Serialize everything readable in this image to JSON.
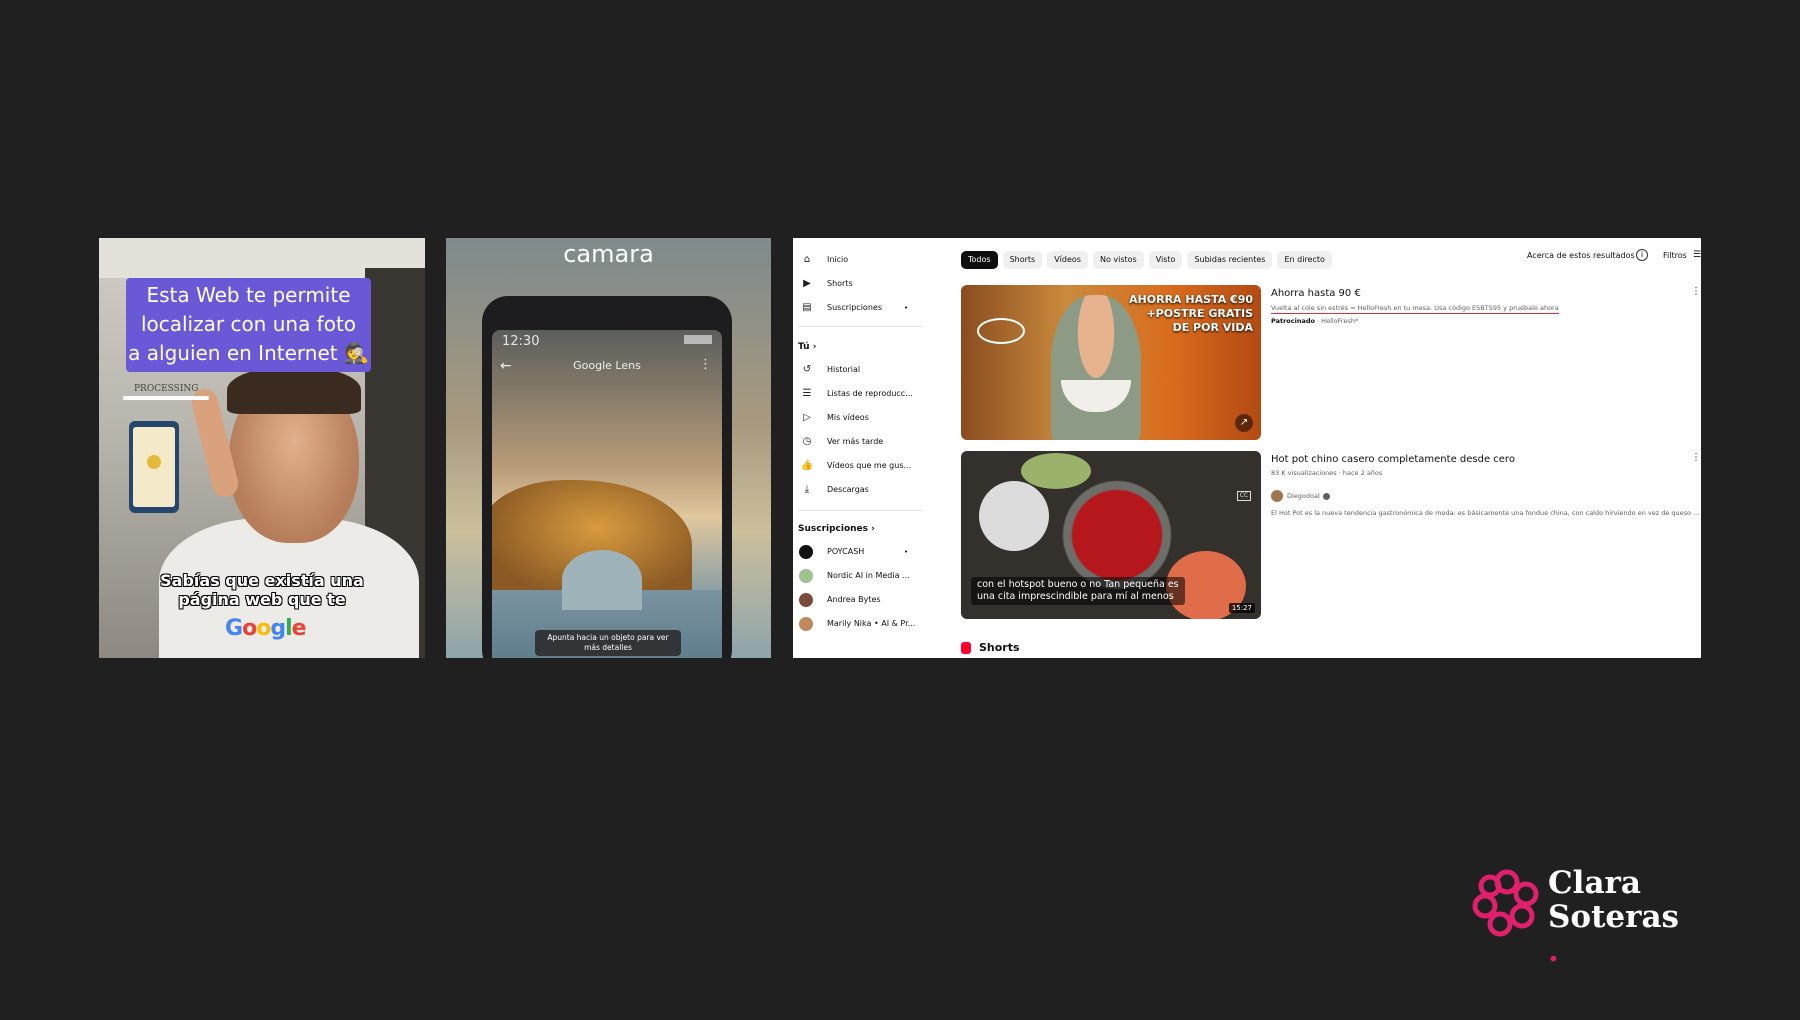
{
  "panel_tiktok": {
    "caption_lines": [
      "Esta Web te permite",
      "localizar con una foto",
      "a alguien en Internet 🕵"
    ],
    "progress_label": "PROCESSING",
    "subtitle_lines": [
      "Sabías que existía una",
      "página web que te"
    ],
    "logo_text": "Google"
  },
  "panel_lens": {
    "title": "camara",
    "time": "12:30",
    "app_label": "Google Lens",
    "hint": "Apunta hacia un objeto para ver más detalles"
  },
  "youtube": {
    "nav": [
      {
        "icon": "home-icon",
        "glyph": "⌂",
        "label": "Inicio"
      },
      {
        "icon": "shorts-icon",
        "glyph": "▶",
        "label": "Shorts"
      },
      {
        "icon": "subscriptions-icon",
        "glyph": "▤",
        "label": "Suscripciones",
        "dot": "•"
      }
    ],
    "you_header": "Tú  ›",
    "you_items": [
      {
        "icon": "history-icon",
        "glyph": "↺",
        "label": "Historial"
      },
      {
        "icon": "playlists-icon",
        "glyph": "☰",
        "label": "Listas de reproducc..."
      },
      {
        "icon": "my-videos-icon",
        "glyph": "▷",
        "label": "Mis vídeos"
      },
      {
        "icon": "watch-later-icon",
        "glyph": "◷",
        "label": "Ver más tarde"
      },
      {
        "icon": "liked-icon",
        "glyph": "👍",
        "label": "Vídeos que me gus..."
      },
      {
        "icon": "downloads-icon",
        "glyph": "⤓",
        "label": "Descargas"
      }
    ],
    "subs_header": "Suscripciones  ›",
    "subs": [
      {
        "label": "POYCASH",
        "color": "#111111",
        "dot": "•"
      },
      {
        "label": "Nordic AI in Media ...",
        "color": "#9bc48f"
      },
      {
        "label": "Andrea Bytes",
        "color": "#7b4a3a"
      },
      {
        "label": "Marily Nika • AI & Pr...",
        "color": "#c0865e"
      }
    ],
    "chips": [
      "Todos",
      "Shorts",
      "Vídeos",
      "No vistos",
      "Visto",
      "Subidas recientes",
      "En directo"
    ],
    "active_chip": "Todos",
    "about_results": "Acerca de estos resultados",
    "filters": "Filtros",
    "ad": {
      "promo_lines": [
        "AHORRA HASTA €90",
        "+POSTRE GRATIS",
        "DE POR VIDA"
      ],
      "title": "Ahorra hasta 90 €",
      "description": "Vuelta al cole sin estrés = HelloFresh en tu mesa. Usa código ESBTS95 y pruébalo ahora",
      "sponsored": "Patrocinado",
      "advertiser": "· HelloFresh*"
    },
    "video": {
      "title": "Hot pot chino casero completamente desde cero",
      "meta": "83 K visualizaciones · hace 2 años",
      "channel": "Diegodoal",
      "description": "El Hot Pot es la nueva tendencia gastronómica de moda: es básicamente una fondue china, con caldo hirviendo en vez de queso ...",
      "caption_lines": [
        "con el hotspot bueno o no Tan pequeña es",
        "una cita imprescindible para mí al menos"
      ],
      "duration": "15:27"
    },
    "shorts_header": "Shorts"
  },
  "brand": {
    "line1": "Clara",
    "line2": "Soteras",
    "dot": ".",
    "accent_color": "#e1206d"
  }
}
